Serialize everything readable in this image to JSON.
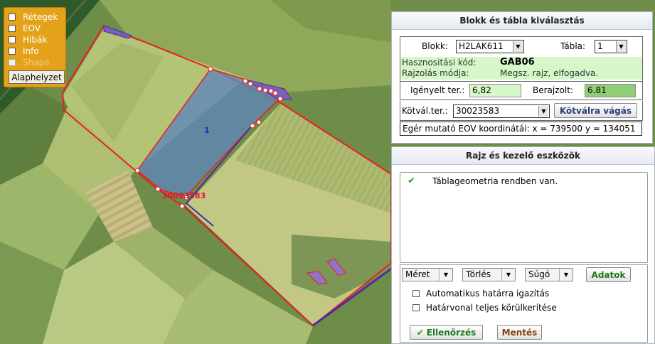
{
  "map": {
    "parcel_number": "1",
    "parcel_label": "30023583"
  },
  "layers": {
    "items": [
      {
        "label": "Rétegek",
        "checked": false,
        "enabled": true
      },
      {
        "label": "EOV",
        "checked": false,
        "enabled": true
      },
      {
        "label": "Hibák",
        "checked": false,
        "enabled": true
      },
      {
        "label": "Info",
        "checked": false,
        "enabled": true
      },
      {
        "label": "Shape",
        "checked": false,
        "enabled": false
      }
    ],
    "reset_label": "Alaphelyzet"
  },
  "block_panel": {
    "title": "Blokk és tábla kiválasztás",
    "block_label": "Blokk:",
    "block_value": "H2LAK611",
    "table_label": "Tábla:",
    "table_value": "1",
    "usage_code_label": "Hasznositási kód:",
    "usage_code_value": "GAB06",
    "drawing_mode_label": "Rajzolás módja:",
    "drawing_mode_value": "Megsz. rajz, elfogadva.",
    "claimed_area_label": "Igényelt ter.:",
    "claimed_area_value": "6,82",
    "drawn_label": "Berajzolt:",
    "drawn_value": "6.81",
    "kotval_label": "Kötvál.ter.:",
    "kotval_value": "30023583",
    "kotval_button": "Kötválra vágás",
    "coords_text": "Egér mutató EOV koordinátái: x = 739500   y = 134051"
  },
  "tools_panel": {
    "title": "Rajz és kezelő eszközök",
    "messages": [
      {
        "icon": "checkmark-icon",
        "text": "Táblageometria rendben van."
      }
    ],
    "buttons": {
      "size": "Méret",
      "delete": "Törlés",
      "help": "Súgó",
      "data": "Adatok"
    },
    "options": [
      {
        "label": "Automatikus határra igazítás",
        "checked": false
      },
      {
        "label": "Határvonal teljes körülkerítése",
        "checked": false
      }
    ],
    "check_button": "Ellenőrzés",
    "save_button": "Mentés"
  },
  "colors": {
    "layers_bg": "#e3a21a",
    "info_green": "#d6f8c9",
    "drawn_green": "#8fce76",
    "parcel_fill": "#5f86b8",
    "boundary_red": "#e82020",
    "ok_green": "#2e9b2e"
  }
}
